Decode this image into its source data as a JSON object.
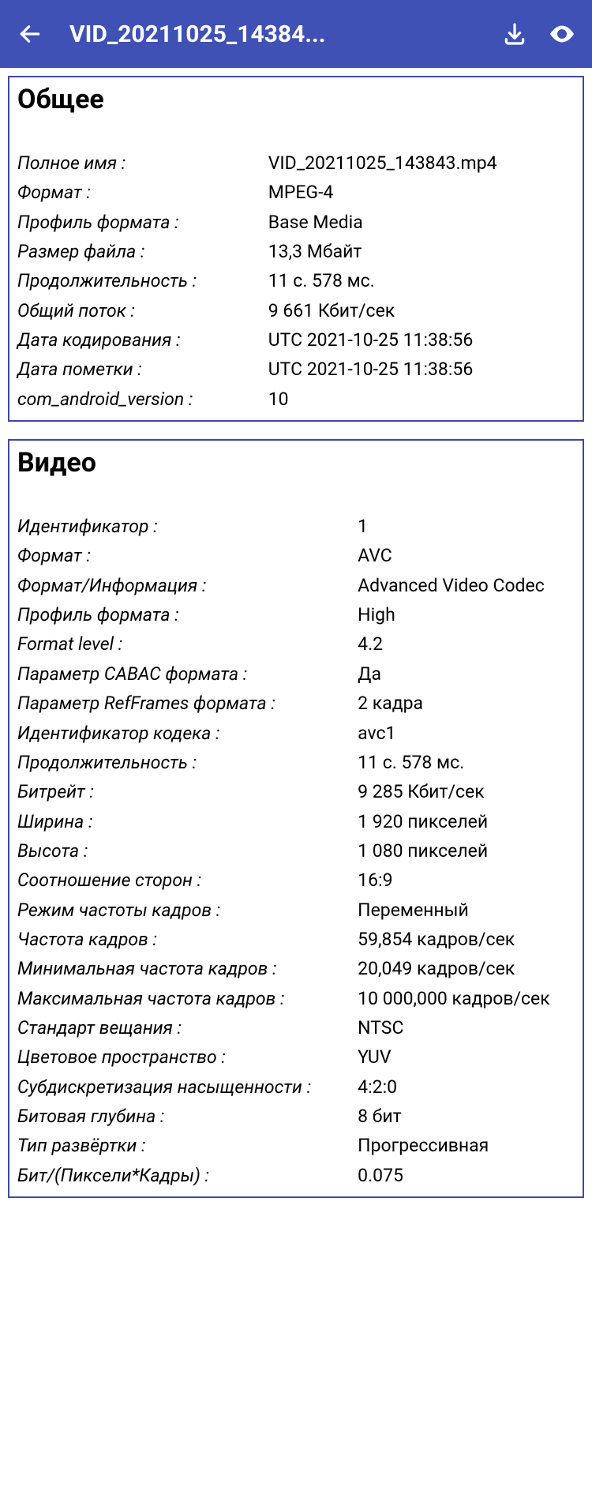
{
  "toolbar": {
    "title": "VID_20211025_14384..."
  },
  "sections": [
    {
      "title": "Общее",
      "rows": [
        {
          "key": "Полное имя :",
          "val": "VID_20211025_143843.mp4"
        },
        {
          "key": "Формат :",
          "val": "MPEG-4"
        },
        {
          "key": "Профиль формата :",
          "val": "Base Media"
        },
        {
          "key": "Размер файла :",
          "val": "13,3 Мбайт"
        },
        {
          "key": "Продолжительность :",
          "val": "11 с. 578 мс."
        },
        {
          "key": "Общий поток :",
          "val": "9 661 Кбит/сек"
        },
        {
          "key": "Дата кодирования :",
          "val": "UTC 2021-10-25 11:38:56"
        },
        {
          "key": "Дата пометки :",
          "val": "UTC 2021-10-25 11:38:56"
        },
        {
          "key": "com_android_version :",
          "val": "10"
        }
      ]
    },
    {
      "title": "Видео",
      "rows": [
        {
          "key": "Идентификатор :",
          "val": "1"
        },
        {
          "key": "Формат :",
          "val": "AVC"
        },
        {
          "key": "Формат/Информация :",
          "val": "Advanced Video Codec"
        },
        {
          "key": "Профиль формата :",
          "val": "High"
        },
        {
          "key": "Format level :",
          "val": "4.2"
        },
        {
          "key": "Параметр CABAC формата :",
          "val": "Да"
        },
        {
          "key": "Параметр RefFrames формата :",
          "val": "2 кадра"
        },
        {
          "key": "Идентификатор кодека :",
          "val": "avc1"
        },
        {
          "key": "Продолжительность :",
          "val": "11 с. 578 мс."
        },
        {
          "key": "Битрейт :",
          "val": "9 285 Кбит/сек"
        },
        {
          "key": "Ширина :",
          "val": "1 920 пикселей"
        },
        {
          "key": "Высота :",
          "val": "1 080 пикселей"
        },
        {
          "key": "Соотношение сторон :",
          "val": "16:9"
        },
        {
          "key": "Режим частоты кадров :",
          "val": "Переменный"
        },
        {
          "key": "Частота кадров :",
          "val": "59,854 кадров/сек"
        },
        {
          "key": "Минимальная частота кадров :",
          "val": "20,049 кадров/сек"
        },
        {
          "key": "Максимальная частота кадров :",
          "val": "10 000,000 кадров/сек"
        },
        {
          "key": "Стандарт вещания :",
          "val": "NTSC"
        },
        {
          "key": "Цветовое пространство :",
          "val": "YUV"
        },
        {
          "key": "Субдискретизация насыщенности :",
          "val": "4:2:0"
        },
        {
          "key": "Битовая глубина :",
          "val": "8 бит"
        },
        {
          "key": "Тип развёртки :",
          "val": "Прогрессивная"
        },
        {
          "key": "Бит/(Пиксели*Кадры) :",
          "val": "0.075"
        }
      ]
    }
  ]
}
